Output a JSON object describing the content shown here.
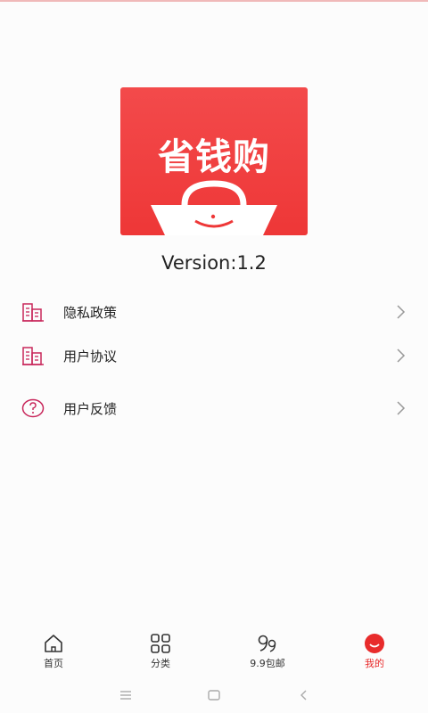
{
  "app": {
    "logo_text": "省钱购",
    "version": "Version:1.2"
  },
  "menu": [
    {
      "label": "隐私政策",
      "icon": "building-icon"
    },
    {
      "label": "用户协议",
      "icon": "building-icon"
    },
    {
      "label": "用户反馈",
      "icon": "question-icon"
    }
  ],
  "tabs": [
    {
      "label": "首页",
      "icon": "home-icon",
      "active": false
    },
    {
      "label": "分类",
      "icon": "grid-icon",
      "active": false
    },
    {
      "label": "9.9包邮",
      "icon": "nine-nine-icon",
      "active": false
    },
    {
      "label": "我的",
      "icon": "profile-icon",
      "active": true
    }
  ],
  "colors": {
    "accent": "#e82b2b",
    "icon_pink": "#c8265a",
    "logo_red": "#f03d3e"
  }
}
